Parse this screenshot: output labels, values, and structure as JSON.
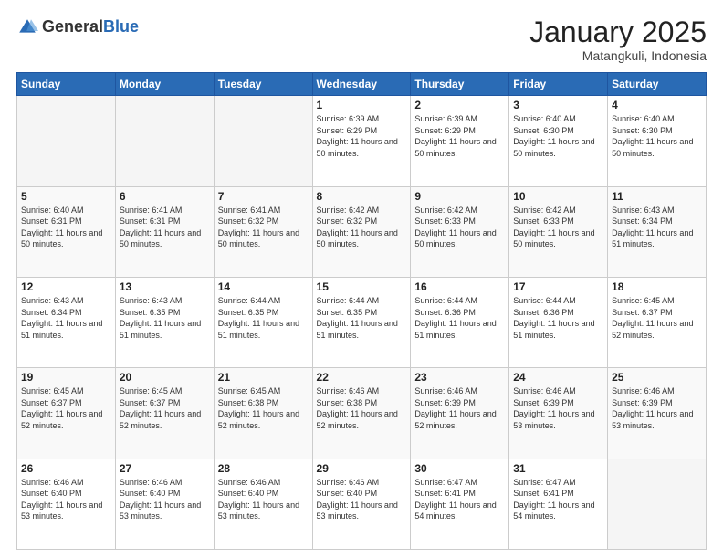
{
  "header": {
    "logo_general": "General",
    "logo_blue": "Blue",
    "title": "January 2025",
    "location": "Matangkuli, Indonesia"
  },
  "days_of_week": [
    "Sunday",
    "Monday",
    "Tuesday",
    "Wednesday",
    "Thursday",
    "Friday",
    "Saturday"
  ],
  "weeks": [
    [
      {
        "day": "",
        "empty": true
      },
      {
        "day": "",
        "empty": true
      },
      {
        "day": "",
        "empty": true
      },
      {
        "day": "1",
        "sunrise": "Sunrise: 6:39 AM",
        "sunset": "Sunset: 6:29 PM",
        "daylight": "Daylight: 11 hours and 50 minutes."
      },
      {
        "day": "2",
        "sunrise": "Sunrise: 6:39 AM",
        "sunset": "Sunset: 6:29 PM",
        "daylight": "Daylight: 11 hours and 50 minutes."
      },
      {
        "day": "3",
        "sunrise": "Sunrise: 6:40 AM",
        "sunset": "Sunset: 6:30 PM",
        "daylight": "Daylight: 11 hours and 50 minutes."
      },
      {
        "day": "4",
        "sunrise": "Sunrise: 6:40 AM",
        "sunset": "Sunset: 6:30 PM",
        "daylight": "Daylight: 11 hours and 50 minutes."
      }
    ],
    [
      {
        "day": "5",
        "sunrise": "Sunrise: 6:40 AM",
        "sunset": "Sunset: 6:31 PM",
        "daylight": "Daylight: 11 hours and 50 minutes."
      },
      {
        "day": "6",
        "sunrise": "Sunrise: 6:41 AM",
        "sunset": "Sunset: 6:31 PM",
        "daylight": "Daylight: 11 hours and 50 minutes."
      },
      {
        "day": "7",
        "sunrise": "Sunrise: 6:41 AM",
        "sunset": "Sunset: 6:32 PM",
        "daylight": "Daylight: 11 hours and 50 minutes."
      },
      {
        "day": "8",
        "sunrise": "Sunrise: 6:42 AM",
        "sunset": "Sunset: 6:32 PM",
        "daylight": "Daylight: 11 hours and 50 minutes."
      },
      {
        "day": "9",
        "sunrise": "Sunrise: 6:42 AM",
        "sunset": "Sunset: 6:33 PM",
        "daylight": "Daylight: 11 hours and 50 minutes."
      },
      {
        "day": "10",
        "sunrise": "Sunrise: 6:42 AM",
        "sunset": "Sunset: 6:33 PM",
        "daylight": "Daylight: 11 hours and 50 minutes."
      },
      {
        "day": "11",
        "sunrise": "Sunrise: 6:43 AM",
        "sunset": "Sunset: 6:34 PM",
        "daylight": "Daylight: 11 hours and 51 minutes."
      }
    ],
    [
      {
        "day": "12",
        "sunrise": "Sunrise: 6:43 AM",
        "sunset": "Sunset: 6:34 PM",
        "daylight": "Daylight: 11 hours and 51 minutes."
      },
      {
        "day": "13",
        "sunrise": "Sunrise: 6:43 AM",
        "sunset": "Sunset: 6:35 PM",
        "daylight": "Daylight: 11 hours and 51 minutes."
      },
      {
        "day": "14",
        "sunrise": "Sunrise: 6:44 AM",
        "sunset": "Sunset: 6:35 PM",
        "daylight": "Daylight: 11 hours and 51 minutes."
      },
      {
        "day": "15",
        "sunrise": "Sunrise: 6:44 AM",
        "sunset": "Sunset: 6:35 PM",
        "daylight": "Daylight: 11 hours and 51 minutes."
      },
      {
        "day": "16",
        "sunrise": "Sunrise: 6:44 AM",
        "sunset": "Sunset: 6:36 PM",
        "daylight": "Daylight: 11 hours and 51 minutes."
      },
      {
        "day": "17",
        "sunrise": "Sunrise: 6:44 AM",
        "sunset": "Sunset: 6:36 PM",
        "daylight": "Daylight: 11 hours and 51 minutes."
      },
      {
        "day": "18",
        "sunrise": "Sunrise: 6:45 AM",
        "sunset": "Sunset: 6:37 PM",
        "daylight": "Daylight: 11 hours and 52 minutes."
      }
    ],
    [
      {
        "day": "19",
        "sunrise": "Sunrise: 6:45 AM",
        "sunset": "Sunset: 6:37 PM",
        "daylight": "Daylight: 11 hours and 52 minutes."
      },
      {
        "day": "20",
        "sunrise": "Sunrise: 6:45 AM",
        "sunset": "Sunset: 6:37 PM",
        "daylight": "Daylight: 11 hours and 52 minutes."
      },
      {
        "day": "21",
        "sunrise": "Sunrise: 6:45 AM",
        "sunset": "Sunset: 6:38 PM",
        "daylight": "Daylight: 11 hours and 52 minutes."
      },
      {
        "day": "22",
        "sunrise": "Sunrise: 6:46 AM",
        "sunset": "Sunset: 6:38 PM",
        "daylight": "Daylight: 11 hours and 52 minutes."
      },
      {
        "day": "23",
        "sunrise": "Sunrise: 6:46 AM",
        "sunset": "Sunset: 6:39 PM",
        "daylight": "Daylight: 11 hours and 52 minutes."
      },
      {
        "day": "24",
        "sunrise": "Sunrise: 6:46 AM",
        "sunset": "Sunset: 6:39 PM",
        "daylight": "Daylight: 11 hours and 53 minutes."
      },
      {
        "day": "25",
        "sunrise": "Sunrise: 6:46 AM",
        "sunset": "Sunset: 6:39 PM",
        "daylight": "Daylight: 11 hours and 53 minutes."
      }
    ],
    [
      {
        "day": "26",
        "sunrise": "Sunrise: 6:46 AM",
        "sunset": "Sunset: 6:40 PM",
        "daylight": "Daylight: 11 hours and 53 minutes."
      },
      {
        "day": "27",
        "sunrise": "Sunrise: 6:46 AM",
        "sunset": "Sunset: 6:40 PM",
        "daylight": "Daylight: 11 hours and 53 minutes."
      },
      {
        "day": "28",
        "sunrise": "Sunrise: 6:46 AM",
        "sunset": "Sunset: 6:40 PM",
        "daylight": "Daylight: 11 hours and 53 minutes."
      },
      {
        "day": "29",
        "sunrise": "Sunrise: 6:46 AM",
        "sunset": "Sunset: 6:40 PM",
        "daylight": "Daylight: 11 hours and 53 minutes."
      },
      {
        "day": "30",
        "sunrise": "Sunrise: 6:47 AM",
        "sunset": "Sunset: 6:41 PM",
        "daylight": "Daylight: 11 hours and 54 minutes."
      },
      {
        "day": "31",
        "sunrise": "Sunrise: 6:47 AM",
        "sunset": "Sunset: 6:41 PM",
        "daylight": "Daylight: 11 hours and 54 minutes."
      },
      {
        "day": "",
        "empty": true
      }
    ]
  ]
}
